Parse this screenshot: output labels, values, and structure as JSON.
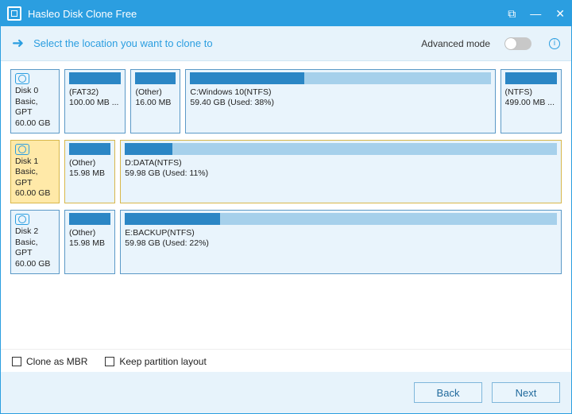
{
  "app": {
    "title": "Hasleo Disk Clone Free"
  },
  "top": {
    "instruction": "Select the location you want to clone to",
    "advanced_label": "Advanced mode"
  },
  "disks": [
    {
      "name": "Disk 0",
      "type": "Basic, GPT",
      "size": "60.00 GB",
      "selected": false,
      "partitions": [
        {
          "label": "(FAT32)",
          "sub": "100.00 MB ...",
          "fill": 100,
          "flex": 0.9
        },
        {
          "label": "(Other)",
          "sub": "16.00 MB",
          "fill": 100,
          "flex": 0.7
        },
        {
          "label": "C:Windows 10(NTFS)",
          "sub": "59.40 GB (Used: 38%)",
          "fill": 38,
          "flex": 5.2
        },
        {
          "label": "(NTFS)",
          "sub": "499.00 MB ...",
          "fill": 100,
          "flex": 0.9
        }
      ]
    },
    {
      "name": "Disk 1",
      "type": "Basic, GPT",
      "size": "60.00 GB",
      "selected": true,
      "partitions": [
        {
          "label": "(Other)",
          "sub": "15.98 MB",
          "fill": 100,
          "flex": 0.75
        },
        {
          "label": "D:DATA(NTFS)",
          "sub": "59.98 GB (Used: 11%)",
          "fill": 11,
          "flex": 7.8
        }
      ]
    },
    {
      "name": "Disk 2",
      "type": "Basic, GPT",
      "size": "60.00 GB",
      "selected": false,
      "partitions": [
        {
          "label": "(Other)",
          "sub": "15.98 MB",
          "fill": 100,
          "flex": 0.75
        },
        {
          "label": "E:BACKUP(NTFS)",
          "sub": "59.98 GB (Used: 22%)",
          "fill": 22,
          "flex": 7.8
        }
      ]
    }
  ],
  "checks": {
    "mbr": "Clone as MBR",
    "keep": "Keep partition layout"
  },
  "footer": {
    "back": "Back",
    "next": "Next"
  }
}
